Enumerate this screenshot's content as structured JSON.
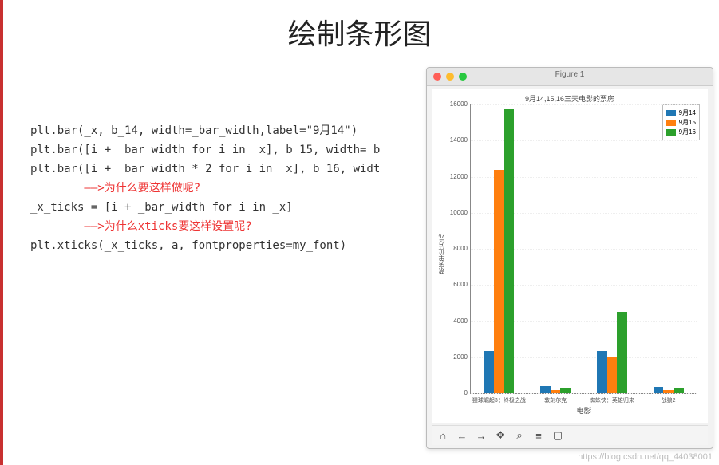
{
  "title": "绘制条形图",
  "code": {
    "l1": "plt.bar(_x, b_14, width=_bar_width,label=\"9月14\")",
    "l2": "plt.bar([i + _bar_width for i in _x], b_15, width=_b",
    "l3": "plt.bar([i + _bar_width * 2 for i in _x], b_16, widt",
    "l4": "        ——>为什么要这样做呢?",
    "l5": "_x_ticks = [i + _bar_width for i in _x]",
    "l6": "        ——>为什么xticks要这样设置呢?",
    "l7": "plt.xticks(_x_ticks, a, fontproperties=my_font)"
  },
  "figure": {
    "window_title": "Figure 1"
  },
  "chart_data": {
    "type": "bar",
    "title": "9月14,15,16三天电影的票房",
    "xlabel": "电影",
    "ylabel": "票房单位:万元",
    "categories": [
      "猩球崛起3：终极之战",
      "敦刻尔克",
      "蜘蛛侠：英雄归来",
      "战狼2"
    ],
    "series": [
      {
        "name": "9月14",
        "color": "#1f77b4",
        "values": [
          2358,
          399,
          2358,
          362
        ]
      },
      {
        "name": "9月15",
        "color": "#ff7f0e",
        "values": [
          12357,
          156,
          2045,
          168
        ]
      },
      {
        "name": "9月16",
        "color": "#2ca02c",
        "values": [
          15746,
          312,
          4497,
          319
        ]
      }
    ],
    "yticks": [
      0,
      2000,
      4000,
      6000,
      8000,
      10000,
      12000,
      14000,
      16000
    ],
    "ylim": [
      0,
      16000
    ]
  },
  "toolbar_icons": [
    "home",
    "back",
    "forward",
    "pan",
    "zoom",
    "configure",
    "save"
  ],
  "watermark": "https://blog.csdn.net/qq_44038001"
}
